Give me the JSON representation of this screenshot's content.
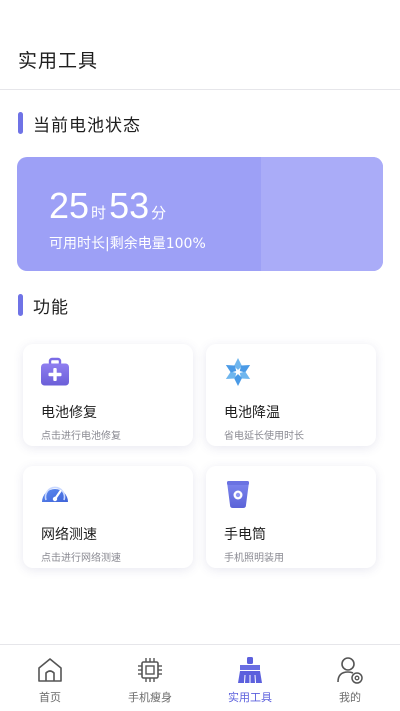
{
  "header": {
    "title": "实用工具"
  },
  "battery_section": {
    "title": "当前电池状态",
    "hours": "25",
    "hours_unit": "时",
    "minutes": "53",
    "minutes_unit": "分",
    "description": "可用时长|剩余电量100%"
  },
  "functions_section": {
    "title": "功能",
    "cards": [
      {
        "name": "电池修复",
        "subtitle": "点击进行电池修复",
        "icon": "medical-kit-icon"
      },
      {
        "name": "电池降温",
        "subtitle": "省电延长使用时长",
        "icon": "snowflake-icon"
      },
      {
        "name": "网络测速",
        "subtitle": "点击进行网络测速",
        "icon": "speedometer-icon"
      },
      {
        "name": "手电筒",
        "subtitle": "手机照明装用",
        "icon": "flashlight-icon"
      }
    ]
  },
  "tab_bar": {
    "items": [
      {
        "label": "首页",
        "icon": "home-icon"
      },
      {
        "label": "手机瘦身",
        "icon": "chip-icon"
      },
      {
        "label": "实用工具",
        "icon": "broom-icon",
        "active": true
      },
      {
        "label": "我的",
        "icon": "user-settings-icon"
      }
    ]
  },
  "colors": {
    "accent": "#6f73e6",
    "battery_card": "#9da0f6",
    "battery_card_right": "#aaacf8",
    "tab_active": "#5c60dd"
  }
}
